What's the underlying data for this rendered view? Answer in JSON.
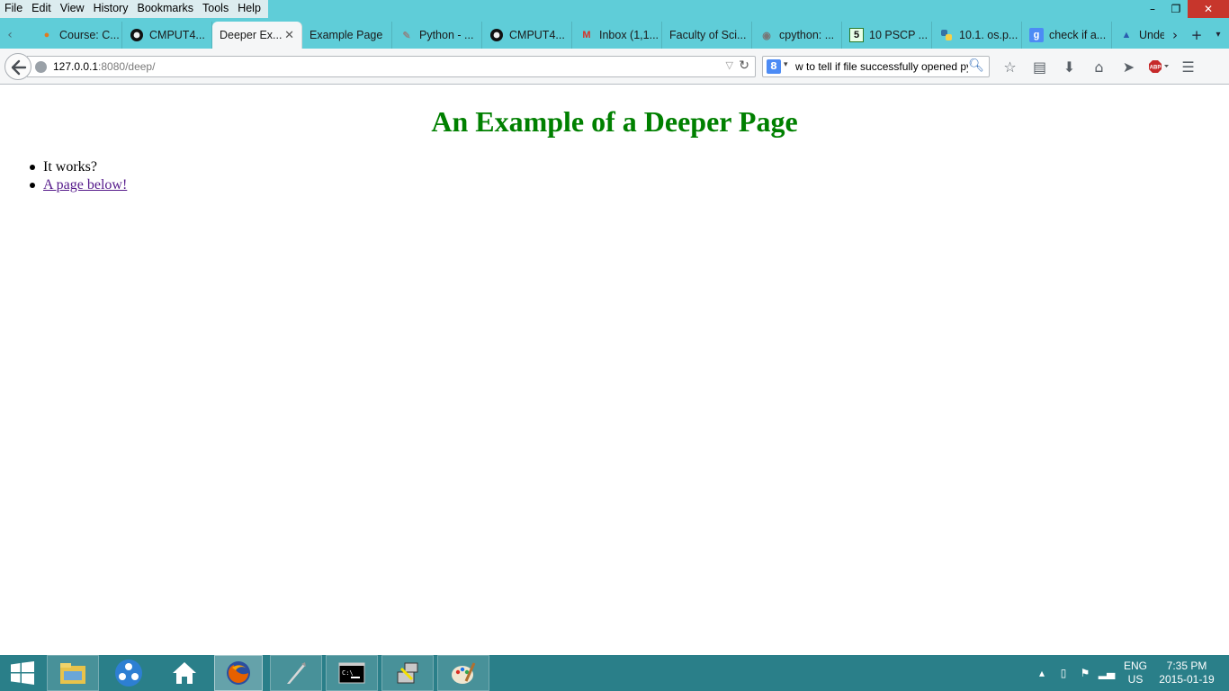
{
  "menubar": {
    "items": [
      {
        "label": "File"
      },
      {
        "label": "Edit"
      },
      {
        "label": "View"
      },
      {
        "label": "History"
      },
      {
        "label": "Bookmarks"
      },
      {
        "label": "Tools"
      },
      {
        "label": "Help"
      }
    ]
  },
  "window_controls": {
    "minimize": "–",
    "restore": "❐",
    "close": "✕"
  },
  "tabs": [
    {
      "title": "Course: C...",
      "icon": "moodle-icon",
      "active": false
    },
    {
      "title": "CMPUT4...",
      "icon": "github-icon",
      "active": false
    },
    {
      "title": "Deeper Ex...",
      "icon": "",
      "active": true
    },
    {
      "title": "Example Page",
      "icon": "",
      "active": false
    },
    {
      "title": "Python - ...",
      "icon": "python-doc-icon",
      "active": false
    },
    {
      "title": "CMPUT4...",
      "icon": "github-icon",
      "active": false
    },
    {
      "title": "Inbox (1,1...",
      "icon": "gmail-icon",
      "active": false
    },
    {
      "title": "Faculty of Sci...",
      "icon": "",
      "active": false
    },
    {
      "title": "cpython: ...",
      "icon": "mercurial-icon",
      "active": false
    },
    {
      "title": "10 PSCP ...",
      "icon": "number-five-icon",
      "active": false
    },
    {
      "title": "10.1. os.p...",
      "icon": "python-icon",
      "active": false
    },
    {
      "title": "check if a...",
      "icon": "google-icon",
      "active": false
    },
    {
      "title": "Under",
      "icon": "ualberta-icon",
      "active": false
    }
  ],
  "tab_tab_close": "✕",
  "address_bar": {
    "host": "127.0.0.1",
    "rest": ":8080/deep/"
  },
  "search_bar": {
    "engine": "8",
    "value": "w to tell if file successfully opened py"
  },
  "toolbar_icons": [
    "bookmark-star-icon",
    "reading-list-icon",
    "downloads-icon",
    "home-icon",
    "share-icon",
    "adblock-icon",
    "menu-icon"
  ],
  "page": {
    "heading": "An Example of a Deeper Page",
    "items": [
      {
        "text": "It works?",
        "link": false
      },
      {
        "text": "A page below!",
        "link": true
      }
    ]
  },
  "taskbar": {
    "apps": [
      "file-explorer-icon",
      "network-icon",
      "home-icon",
      "firefox-icon",
      "quill-icon",
      "command-prompt-icon",
      "network-config-icon",
      "paint-icon"
    ]
  },
  "tray": {
    "lang_top": "ENG",
    "lang_bottom": "US",
    "time": "7:35 PM",
    "date": "2015-01-19"
  },
  "colors": {
    "chrome": "#5fcdd8",
    "heading": "#008000",
    "visited_link": "#551a8b",
    "taskbar": "#2a7f89"
  }
}
